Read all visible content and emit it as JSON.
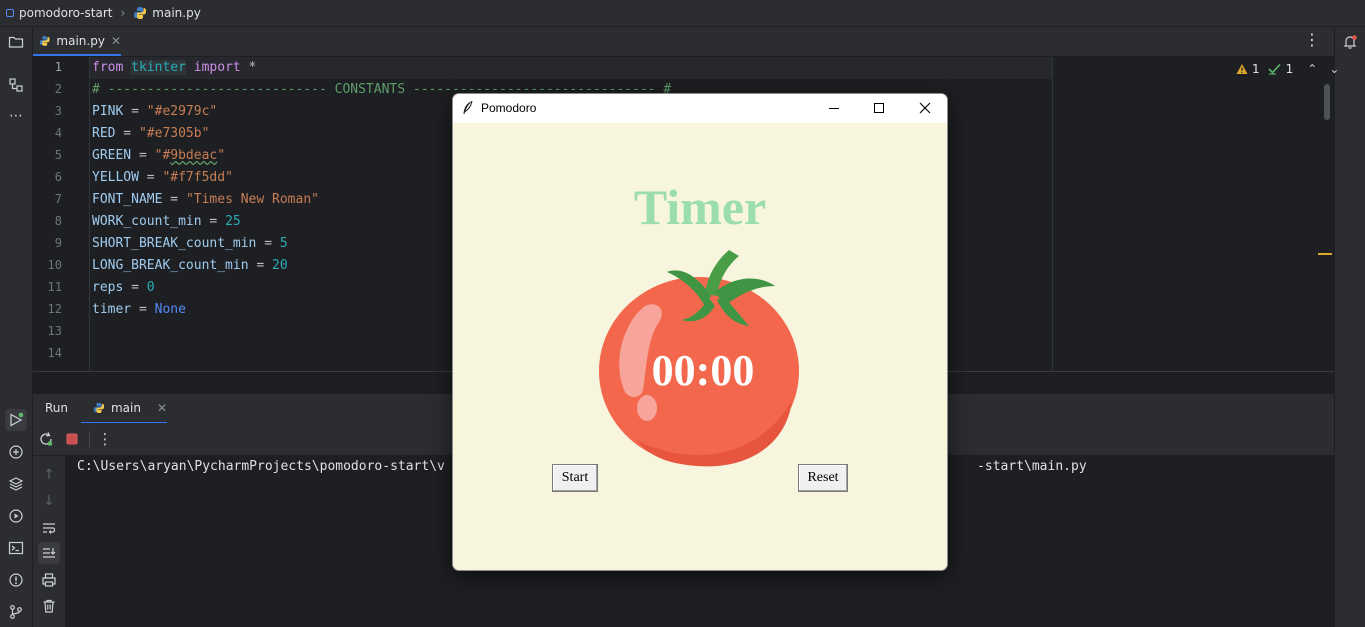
{
  "navbar": {
    "project": "pomodoro-start",
    "file": "main.py"
  },
  "editor": {
    "tab_label": "main.py",
    "inspections": {
      "warnings": "1",
      "ok": "1"
    },
    "line_numbers": [
      "1",
      "2",
      "3",
      "4",
      "5",
      "6",
      "7",
      "8",
      "9",
      "10",
      "11",
      "12",
      "13",
      "14"
    ],
    "lines": {
      "l1": {
        "kw1": "from",
        "mod": "tkinter",
        "kw2": "import",
        "rest": " *"
      },
      "l2": {
        "comment": "# ---------------------------- CONSTANTS ------------------------------- #"
      },
      "l3": {
        "name": "PINK",
        "op": " = ",
        "value": "\"#e2979c\""
      },
      "l4": {
        "name": "RED",
        "op": " = ",
        "value": "\"#e7305b\""
      },
      "l5": {
        "name": "GREEN",
        "op": " = ",
        "value_a": "\"#",
        "value_b": "9bdeac",
        "value_c": "\""
      },
      "l6": {
        "name": "YELLOW",
        "op": " = ",
        "value": "\"#f7f5dd\""
      },
      "l7": {
        "name": "FONT_NAME",
        "op": " = ",
        "value": "\"Times New Roman\""
      },
      "l8": {
        "name": "WORK_count_min",
        "op": " = ",
        "value": "25"
      },
      "l9": {
        "name": "SHORT_BREAK_count_min",
        "op": " = ",
        "value": "5"
      },
      "l10": {
        "name": "LONG_BREAK_count_min",
        "op": " = ",
        "value": "20"
      },
      "l11": {
        "name": "reps",
        "op": " = ",
        "value": "0"
      },
      "l12": {
        "name": "timer",
        "op": " = ",
        "value": "None"
      }
    }
  },
  "run": {
    "title": "Run",
    "tab_label": "main",
    "console_line": "C:\\Users\\aryan\\PycharmProjects\\pomodoro-start\\v                                                                    -start\\main.py"
  },
  "tk_window": {
    "title": "Pomodoro",
    "heading": "Timer",
    "time": "00:00",
    "start_label": "Start",
    "reset_label": "Reset"
  },
  "colors": {
    "pink": "#e2979c",
    "red": "#e7305b",
    "green": "#9bdeac",
    "yellow": "#f7f5dd",
    "accent": "#3574f0"
  }
}
